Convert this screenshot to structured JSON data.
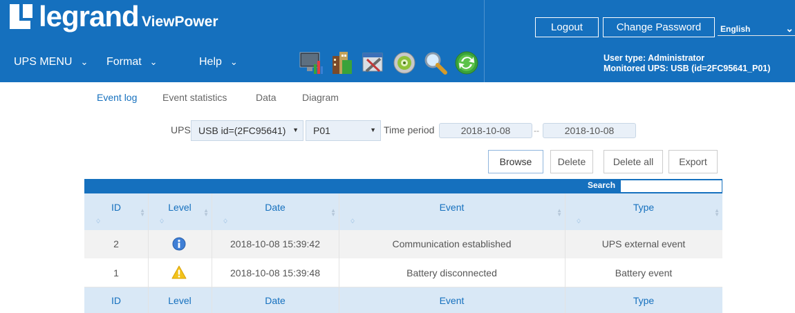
{
  "header": {
    "brand": "legrand",
    "product": "ViewPower",
    "logout_label": "Logout",
    "change_password_label": "Change Password",
    "language": "English",
    "user_type": "User type: Administrator",
    "monitored_ups": "Monitored UPS: USB (id=2FC95641_P01)",
    "accent_color": "#1570be"
  },
  "menu": {
    "items": [
      {
        "label": "UPS MENU"
      },
      {
        "label": "Format"
      },
      {
        "label": "Help"
      }
    ]
  },
  "toolbar": {
    "icons": [
      "monitor-chart-icon",
      "buildings-icon",
      "tools-icon",
      "gear-disc-icon",
      "magnifier-icon",
      "refresh-icon"
    ]
  },
  "tabs": [
    {
      "label": "Event log",
      "active": true
    },
    {
      "label": "Event statistics",
      "active": false
    },
    {
      "label": "Data",
      "active": false
    },
    {
      "label": "Diagram",
      "active": false
    }
  ],
  "filters": {
    "ups_label": "UPS",
    "ups_value": "USB id=(2FC95641)",
    "port_value": "P01",
    "time_period_label": "Time period",
    "date_from": "2018-10-08",
    "date_sep": "--",
    "date_to": "2018-10-08"
  },
  "actions": {
    "browse": "Browse",
    "delete": "Delete",
    "delete_all": "Delete all",
    "export": "Export"
  },
  "table": {
    "search_label": "Search",
    "columns": [
      "ID",
      "Level",
      "Date",
      "Event",
      "Type"
    ],
    "rows": [
      {
        "id": "2",
        "level": "info",
        "date": "2018-10-08 15:39:42",
        "event": "Communication established",
        "type": "UPS external event"
      },
      {
        "id": "1",
        "level": "warning",
        "date": "2018-10-08 15:39:48",
        "event": "Battery disconnected",
        "type": "Battery event"
      }
    ]
  }
}
